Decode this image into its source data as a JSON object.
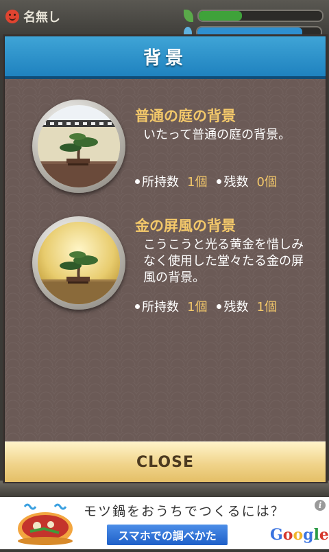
{
  "status": {
    "user_name": "名無し",
    "bar1_level": 0.35,
    "bar2_level": 0.85,
    "bar1_color": "#3fa23a",
    "bar2_color": "#2d8fd0"
  },
  "modal": {
    "title": "背景",
    "header_color": "#2a93cc",
    "items": [
      {
        "title": "普通の庭の背景",
        "description": "いたって普通の庭の背景。",
        "owned_label": "所持数",
        "owned_value": "1個",
        "remaining_label": "残数",
        "remaining_value": "0個",
        "icon": "bonsai-garden-icon"
      },
      {
        "title": "金の屏風の背景",
        "description": "こうこうと光る黄金を惜しみなく使用した堂々たる金の屏風の背景。",
        "owned_label": "所持数",
        "owned_value": "1個",
        "remaining_label": "残数",
        "remaining_value": "1個",
        "icon": "bonsai-gold-screen-icon"
      }
    ],
    "close_label": "CLOSE"
  },
  "ad": {
    "headline": "モツ鍋をおうちでつくるには？",
    "button_label": "スマホでの調べかた",
    "brand": "Google",
    "info_icon": "info-icon"
  }
}
